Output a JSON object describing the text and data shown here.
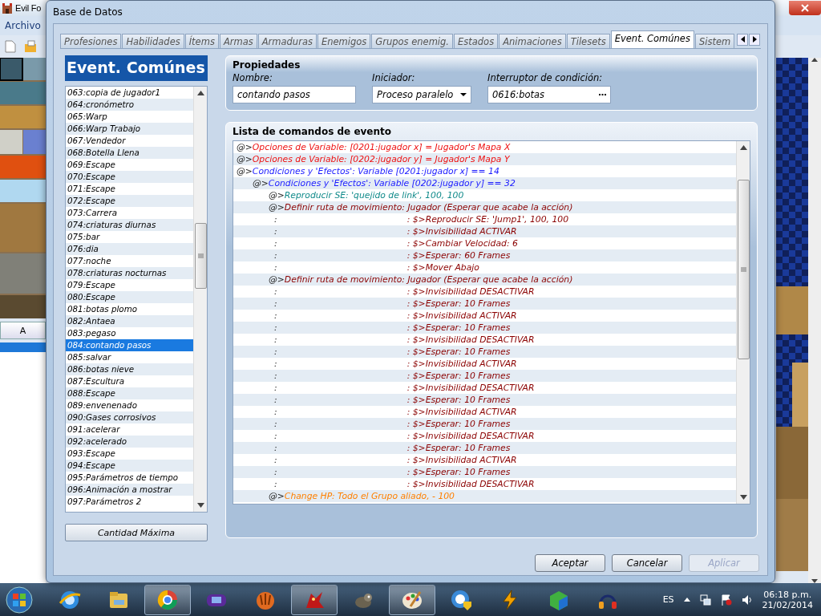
{
  "background_window": {
    "title": "Evil Fo",
    "menu": [
      "Archivo"
    ],
    "palette_button": "A"
  },
  "dialog": {
    "title": "Base de Datos",
    "tabs": [
      {
        "label": "Profesiones",
        "selected": false
      },
      {
        "label": "Habilidades",
        "selected": false
      },
      {
        "label": "Ítems",
        "selected": false
      },
      {
        "label": "Armas",
        "selected": false
      },
      {
        "label": "Armaduras",
        "selected": false
      },
      {
        "label": "Enemigos",
        "selected": false
      },
      {
        "label": "Grupos enemig.",
        "selected": false
      },
      {
        "label": "Estados",
        "selected": false
      },
      {
        "label": "Animaciones",
        "selected": false
      },
      {
        "label": "Tilesets",
        "selected": false
      },
      {
        "label": "Event. Comúnes",
        "selected": true
      },
      {
        "label": "Sistem",
        "selected": false
      }
    ],
    "event_list": {
      "header": "Event. Comúnes",
      "button": "Cantidad Máxima",
      "items": [
        {
          "label": "063:copia de jugador1",
          "selected": false
        },
        {
          "label": "064:cronómetro",
          "selected": false
        },
        {
          "label": "065:Warp",
          "selected": false
        },
        {
          "label": "066:Warp Trabajo",
          "selected": false
        },
        {
          "label": "067:Vendedor",
          "selected": false
        },
        {
          "label": "068:Botella Llena",
          "selected": false
        },
        {
          "label": "069:Escape",
          "selected": false
        },
        {
          "label": "070:Escape",
          "selected": false
        },
        {
          "label": "071:Escape",
          "selected": false
        },
        {
          "label": "072:Escape",
          "selected": false
        },
        {
          "label": "073:Carrera",
          "selected": false
        },
        {
          "label": "074:criaturas diurnas",
          "selected": false
        },
        {
          "label": "075:bar",
          "selected": false
        },
        {
          "label": "076:dia",
          "selected": false
        },
        {
          "label": "077:noche",
          "selected": false
        },
        {
          "label": "078:criaturas nocturnas",
          "selected": false
        },
        {
          "label": "079:Escape",
          "selected": false
        },
        {
          "label": "080:Escape",
          "selected": false
        },
        {
          "label": "081:botas plomo",
          "selected": false
        },
        {
          "label": "082:Antaea",
          "selected": false
        },
        {
          "label": "083:pegaso",
          "selected": false
        },
        {
          "label": "084:contando pasos",
          "selected": true
        },
        {
          "label": "085:salvar",
          "selected": false
        },
        {
          "label": "086:botas nieve",
          "selected": false
        },
        {
          "label": "087:Escultura",
          "selected": false
        },
        {
          "label": "088:Escape",
          "selected": false
        },
        {
          "label": "089:envenenado",
          "selected": false
        },
        {
          "label": "090:Gases corrosivos",
          "selected": false
        },
        {
          "label": "091:acelerar",
          "selected": false
        },
        {
          "label": "092:acelerado",
          "selected": false
        },
        {
          "label": "093:Escape",
          "selected": false
        },
        {
          "label": "094:Escape",
          "selected": false
        },
        {
          "label": "095:Parámetros de tiempo",
          "selected": false
        },
        {
          "label": "096:Animación a mostrar",
          "selected": false
        },
        {
          "label": "097:Parámetros 2",
          "selected": false
        }
      ]
    },
    "properties": {
      "title": "Propiedades",
      "name": {
        "label": "Nombre:",
        "value": "contando pasos"
      },
      "trigger": {
        "label": "Iniciador:",
        "value": "Proceso paralelo"
      },
      "switch": {
        "label": "Interruptor de condición:",
        "value": "0616:botas"
      }
    },
    "commands": {
      "title": "Lista de comandos de evento",
      "rows": [
        {
          "kind": "command",
          "prefix": "@>",
          "text": "Opciones de Variable: [0201:jugador x] = Jugador's Mapa X",
          "color": "#ee1111"
        },
        {
          "kind": "command",
          "prefix": "@>",
          "text": "Opciones de Variable: [0202:jugador y] = Jugador's Mapa Y",
          "color": "#ee1111"
        },
        {
          "kind": "command",
          "prefix": "@>",
          "text": "Condiciones y 'Efectos': Variable [0201:jugador x] == 14",
          "color": "#1a1aff",
          "children": [
            {
              "kind": "command",
              "prefix": "@>",
              "text": "Condiciones y 'Efectos': Variable [0202:jugador y] == 32",
              "color": "#1a1aff",
              "children": [
                {
                  "kind": "command",
                  "prefix": "@>",
                  "text": "Reproducir SE: 'quejido de link', 100, 100",
                  "color": "#108a8a"
                },
                {
                  "kind": "command",
                  "prefix": "@>",
                  "text": "Definir ruta de movimiento: Jugador (Esperar que acabe la acción)",
                  "color": "#8b0000",
                  "children": [
                    {
                      "kind": "route",
                      "marker": ":",
                      "text": ": $>Reproducir SE: 'Jump1', 100, 100",
                      "color": "#8b0000"
                    },
                    {
                      "kind": "route",
                      "marker": ":",
                      "text": ": $>Invisibilidad ACTIVAR",
                      "color": "#8b0000"
                    },
                    {
                      "kind": "route",
                      "marker": ":",
                      "text": ": $>Cambiar Velocidad: 6",
                      "color": "#8b0000"
                    },
                    {
                      "kind": "route",
                      "marker": ":",
                      "text": ": $>Esperar: 60 Frames",
                      "color": "#8b0000"
                    },
                    {
                      "kind": "route",
                      "marker": ":",
                      "text": ": $>Mover Abajo",
                      "color": "#8b0000"
                    }
                  ]
                },
                {
                  "kind": "command",
                  "prefix": "@>",
                  "text": "Definir ruta de movimiento: Jugador (Esperar que acabe la acción)",
                  "color": "#8b0000",
                  "children": [
                    {
                      "kind": "route",
                      "marker": ":",
                      "text": ": $>Invisibilidad DESACTIVAR",
                      "color": "#8b0000"
                    },
                    {
                      "kind": "route",
                      "marker": ":",
                      "text": ": $>Esperar: 10 Frames",
                      "color": "#8b0000"
                    },
                    {
                      "kind": "route",
                      "marker": ":",
                      "text": ": $>Invisibilidad ACTIVAR",
                      "color": "#8b0000"
                    },
                    {
                      "kind": "route",
                      "marker": ":",
                      "text": ": $>Esperar: 10 Frames",
                      "color": "#8b0000"
                    },
                    {
                      "kind": "route",
                      "marker": ":",
                      "text": ": $>Invisibilidad DESACTIVAR",
                      "color": "#8b0000"
                    },
                    {
                      "kind": "route",
                      "marker": ":",
                      "text": ": $>Esperar: 10 Frames",
                      "color": "#8b0000"
                    },
                    {
                      "kind": "route",
                      "marker": ":",
                      "text": ": $>Invisibilidad ACTIVAR",
                      "color": "#8b0000"
                    },
                    {
                      "kind": "route",
                      "marker": ":",
                      "text": ": $>Esperar: 10 Frames",
                      "color": "#8b0000"
                    },
                    {
                      "kind": "route",
                      "marker": ":",
                      "text": ": $>Invisibilidad DESACTIVAR",
                      "color": "#8b0000"
                    },
                    {
                      "kind": "route",
                      "marker": ":",
                      "text": ": $>Esperar: 10 Frames",
                      "color": "#8b0000"
                    },
                    {
                      "kind": "route",
                      "marker": ":",
                      "text": ": $>Invisibilidad ACTIVAR",
                      "color": "#8b0000"
                    },
                    {
                      "kind": "route",
                      "marker": ":",
                      "text": ": $>Esperar: 10 Frames",
                      "color": "#8b0000"
                    },
                    {
                      "kind": "route",
                      "marker": ":",
                      "text": ": $>Invisibilidad DESACTIVAR",
                      "color": "#8b0000"
                    },
                    {
                      "kind": "route",
                      "marker": ":",
                      "text": ": $>Esperar: 10 Frames",
                      "color": "#8b0000"
                    },
                    {
                      "kind": "route",
                      "marker": ":",
                      "text": ": $>Invisibilidad ACTIVAR",
                      "color": "#8b0000"
                    },
                    {
                      "kind": "route",
                      "marker": ":",
                      "text": ": $>Esperar: 10 Frames",
                      "color": "#8b0000"
                    },
                    {
                      "kind": "route",
                      "marker": ":",
                      "text": ": $>Invisibilidad DESACTIVAR",
                      "color": "#8b0000"
                    }
                  ]
                },
                {
                  "kind": "command",
                  "prefix": "@>",
                  "text": "Change HP: Todo el Grupo aliado, - 100",
                  "color": "#ff8000"
                }
              ]
            }
          ]
        }
      ]
    },
    "buttons": [
      {
        "label": "Aceptar",
        "disabled": false
      },
      {
        "label": "Cancelar",
        "disabled": false
      },
      {
        "label": "Aplicar",
        "disabled": true
      }
    ]
  },
  "taskbar": {
    "apps": [
      {
        "kind": "globe",
        "running": false
      },
      {
        "kind": "folder",
        "running": false
      },
      {
        "kind": "wheel",
        "running": true
      },
      {
        "kind": "gamepad",
        "running": false
      },
      {
        "kind": "glove",
        "running": false
      },
      {
        "kind": "dragon",
        "running": true
      },
      {
        "kind": "animal",
        "running": false
      },
      {
        "kind": "palette",
        "running": true
      },
      {
        "kind": "shield",
        "running": false
      },
      {
        "kind": "bolt",
        "running": false
      },
      {
        "kind": "cube",
        "running": false
      },
      {
        "kind": "headphones",
        "running": false
      }
    ],
    "language": "ES",
    "time": "06:18 p.m.",
    "date": "21/02/2014"
  }
}
